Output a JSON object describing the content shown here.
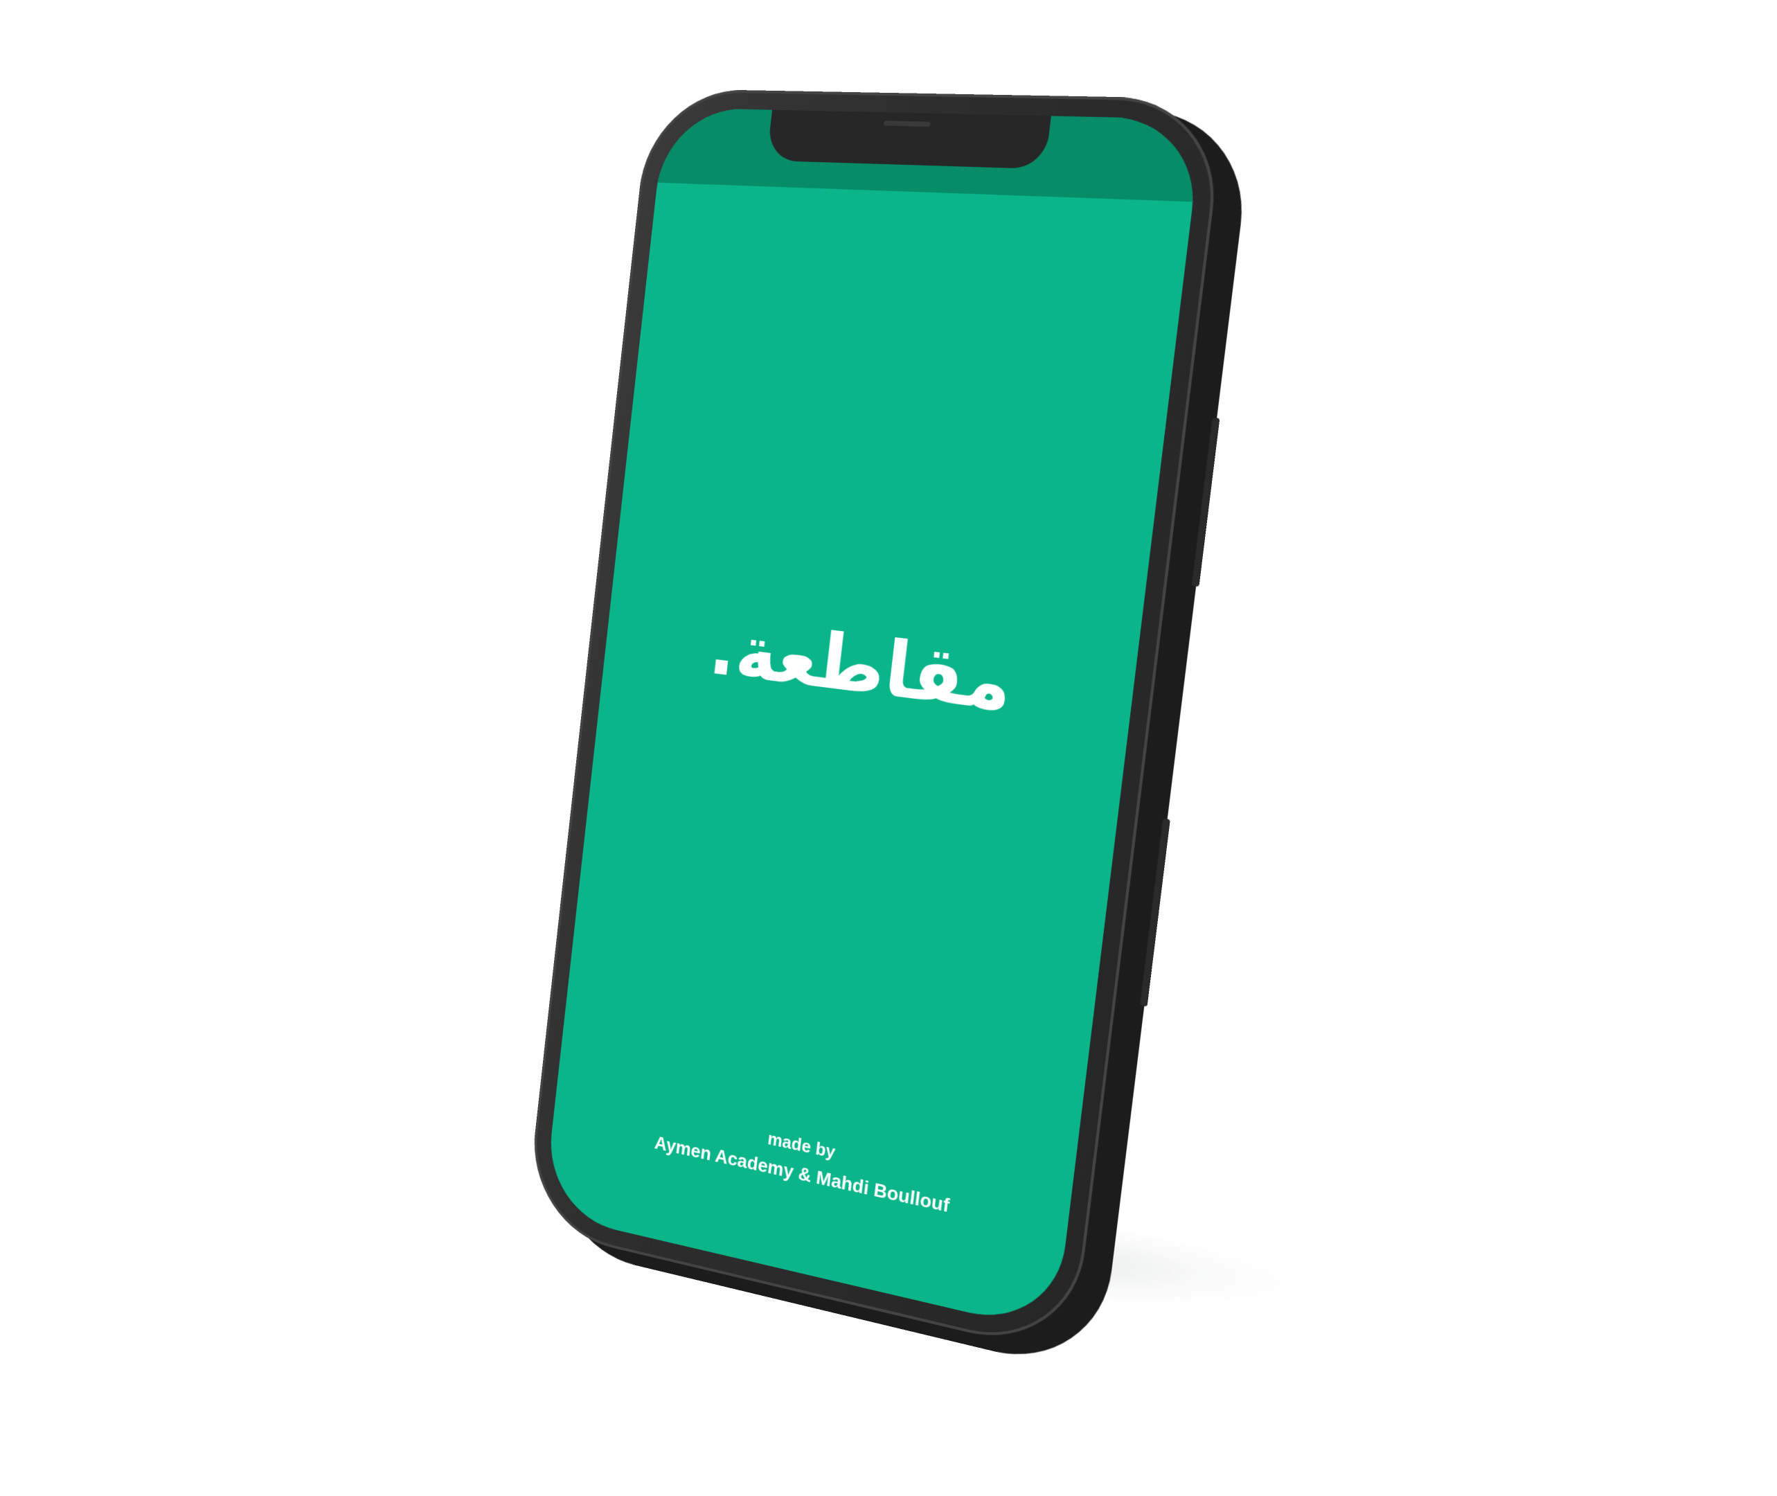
{
  "app": {
    "logo_text": "مقاطعة.",
    "credit_prefix": "made by",
    "credit_names": "Aymen Academy & Mahdi Boullouf"
  },
  "colors": {
    "screen_background": "#0bb58a",
    "status_bar": "#078c68",
    "text": "#ffffff",
    "device_frame": "#2d2d2d"
  }
}
